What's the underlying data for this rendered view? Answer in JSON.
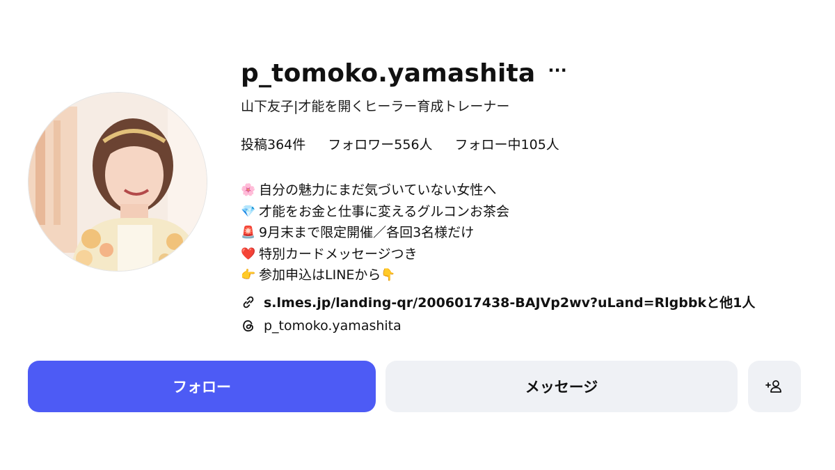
{
  "profile": {
    "username": "p_tomoko.yamashita",
    "more_icon": "···",
    "full_name": "山下友子|才能を開くヒーラー育成トレーナー",
    "stats": {
      "posts": "投稿364件",
      "followers": "フォロワー556人",
      "following": "フォロー中105人"
    },
    "bio": [
      {
        "emoji": "🌸",
        "text": "自分の魅力にまだ気づいていない女性へ"
      },
      {
        "emoji": "💎",
        "text": "才能をお金と仕事に変えるグルコンお茶会"
      },
      {
        "emoji": "🚨",
        "text": "9月末まで限定開催／各回3名様だけ"
      },
      {
        "emoji": "❤️",
        "text": "特別カードメッセージつき"
      },
      {
        "emoji": "👉",
        "text": "参加申込はLINEから",
        "trail": "👇"
      }
    ],
    "link": "s.lmes.jp/landing-qr/2006017438-BAJVp2wv?uLand=Rlgbbkと他1人",
    "threads": "p_tomoko.yamashita"
  },
  "buttons": {
    "follow": "フォロー",
    "message": "メッセージ"
  },
  "icons": {
    "more": "more-icon",
    "link": "link-icon",
    "threads": "threads-icon",
    "add_person": "add-person-icon"
  },
  "colors": {
    "follow_bg": "#4d5bf5",
    "secondary_bg": "#eff1f5"
  }
}
